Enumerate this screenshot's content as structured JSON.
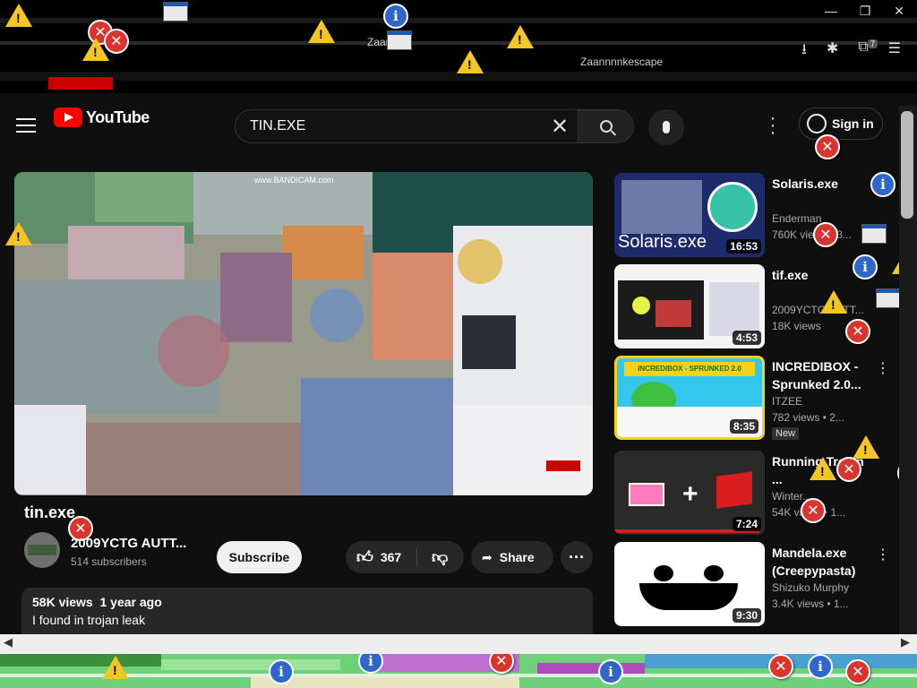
{
  "browser": {
    "window_controls": [
      "—",
      "❐",
      "✕"
    ],
    "extension_badge": "7",
    "glitch_text": [
      "Zaannnni",
      "Zaannnnkescape"
    ]
  },
  "header": {
    "logo_text": "YouTube",
    "search_value": "TIN.EXE",
    "signin_label": "Sign in"
  },
  "video": {
    "title": "tin.exe",
    "channel": "2009YCTG AUTT...",
    "subscribers": "514 subscribers",
    "subscribe_label": "Subscribe",
    "likes": "367",
    "share_label": "Share",
    "views": "58K views",
    "age": "1 year ago",
    "description": "I found in trojan leak",
    "watermark": "www.BANDICAM.com"
  },
  "recommendations": [
    {
      "title": "Solaris.exe",
      "channel": "Enderman",
      "views": "760K views • 3...",
      "duration": "16:53",
      "thumb_text": "Solaris.exe"
    },
    {
      "title": "tif.exe",
      "channel": "2009YCTG AUTT...",
      "views": "18K views",
      "duration": "4:53"
    },
    {
      "title": "INCREDIBOX - Sprunked 2.0...",
      "channel": "ITZEE",
      "views": "782 views • 2...",
      "duration": "8:35",
      "badge": "New",
      "thumb_text": "INCREDIBOX - SPRUNKED 2.0"
    },
    {
      "title": "Running Trojan ...",
      "channel": "Winter...",
      "views": "54K views • 1...",
      "duration": "7:24"
    },
    {
      "title": "Mandela.exe (Creepypasta)",
      "channel": "Shizuko Murphy",
      "views": "3.4K views • 1...",
      "duration": "9:30"
    }
  ],
  "colors": {
    "accent": "#ff0000",
    "background": "#0f0f0f",
    "error": "#d9352e",
    "info": "#2f66c9",
    "warning": "#f3c623"
  },
  "icons": [
    "hamburger-icon",
    "youtube-logo-icon",
    "search-icon",
    "clear-icon",
    "mic-icon",
    "kebab-icon",
    "user-icon",
    "like-icon",
    "dislike-icon",
    "share-icon",
    "error-icon",
    "info-icon",
    "warning-icon"
  ]
}
